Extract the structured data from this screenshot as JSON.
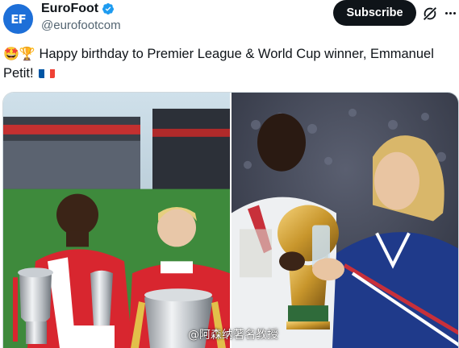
{
  "author": {
    "display_name": "EuroFoot",
    "handle": "@eurofootcom",
    "avatar_text": "EF",
    "verified": true
  },
  "header": {
    "subscribe_label": "Subscribe",
    "grok_icon": "grok-icon",
    "more_icon": "more-options-icon"
  },
  "tweet": {
    "emojis": "🤩🏆",
    "text": "Happy birthday to Premier League & World Cup winner, Emmanuel Petit!",
    "flag": "france-flag"
  },
  "media": {
    "watermark": "@阿森纳著名教授"
  },
  "colors": {
    "subscribe_bg": "#0f1419",
    "verified_blue": "#1d9bf0",
    "handle_gray": "#536471",
    "arsenal_red": "#d8262f",
    "france_blue": "#1f3a8a"
  }
}
